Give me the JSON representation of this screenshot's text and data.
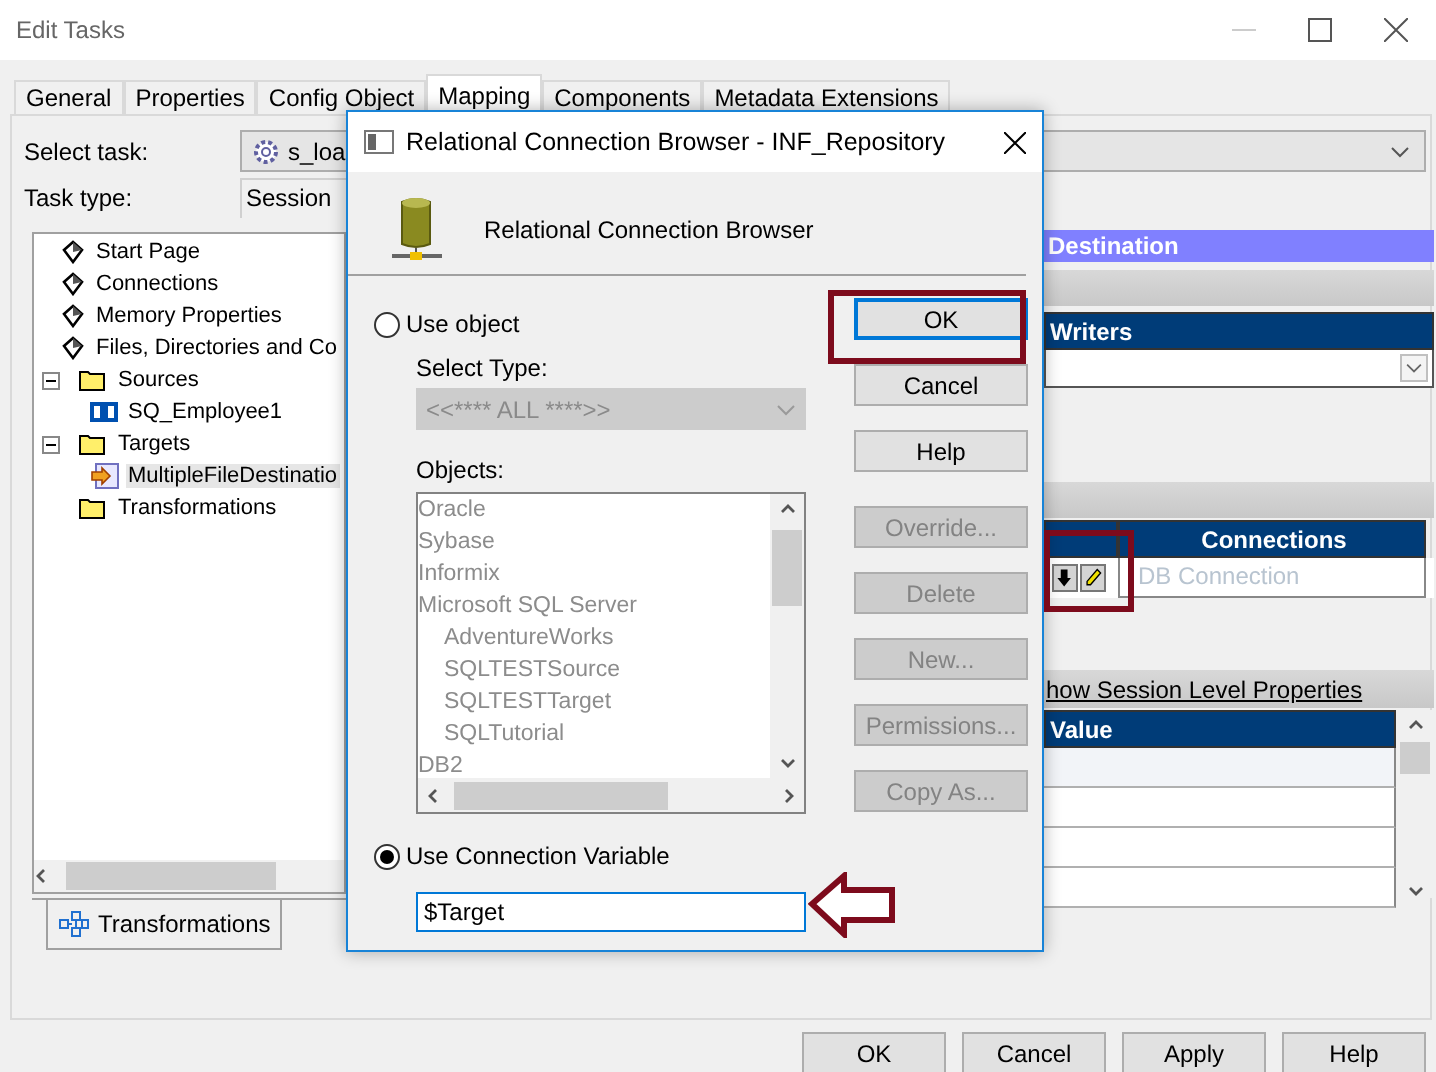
{
  "window": {
    "title": "Edit Tasks"
  },
  "tabs": [
    {
      "label": "General",
      "selected": false
    },
    {
      "label": "Properties",
      "selected": false
    },
    {
      "label": "Config Object",
      "selected": false
    },
    {
      "label": "Mapping",
      "selected": true
    },
    {
      "label": "Components",
      "selected": false
    },
    {
      "label": "Metadata Extensions",
      "selected": false
    }
  ],
  "task": {
    "select_label": "Select task:",
    "select_value": "s_loa",
    "type_label": "Task type:",
    "type_value": "Session"
  },
  "tree": [
    {
      "label": "Start Page",
      "kind": "page",
      "selected": false
    },
    {
      "label": "Connections",
      "kind": "page",
      "selected": false
    },
    {
      "label": "Memory Properties",
      "kind": "page",
      "selected": false
    },
    {
      "label": "Files, Directories and Co",
      "kind": "page",
      "selected": false
    },
    {
      "label": "Sources",
      "kind": "folder",
      "expanded": true,
      "selected": false,
      "children": [
        {
          "label": "SQ_Employee1",
          "kind": "source",
          "selected": false
        }
      ]
    },
    {
      "label": "Targets",
      "kind": "folder",
      "expanded": true,
      "selected": false,
      "children": [
        {
          "label": "MultipleFileDestinatio",
          "kind": "target",
          "selected": true
        }
      ]
    },
    {
      "label": "Transformations",
      "kind": "folder",
      "selected": false
    }
  ],
  "bottom_tab": "Transformations",
  "properties": {
    "header": "Destination",
    "writers_header": "Writers",
    "connections_header": "Connections",
    "connection_value": "DB Connection",
    "link": "how Session Level Properties",
    "value_header": "Value"
  },
  "dialog": {
    "title": "Relational Connection Browser - INF_Repository",
    "heading": "Relational Connection Browser",
    "options": [
      {
        "label": "Use object",
        "selected": false
      },
      {
        "label": "Use Connection Variable",
        "selected": true
      }
    ],
    "select_type_label": "Select Type:",
    "select_type_value": "<<**** ALL ****>>",
    "objects_label": "Objects:",
    "objects": [
      {
        "label": "Oracle"
      },
      {
        "label": "Sybase"
      },
      {
        "label": "Informix"
      },
      {
        "label": "Microsoft SQL Server",
        "children": [
          {
            "label": "AdventureWorks"
          },
          {
            "label": "SQLTESTSource"
          },
          {
            "label": "SQLTESTTarget"
          },
          {
            "label": "SQLTutorial"
          }
        ]
      },
      {
        "label": "DB2"
      }
    ],
    "variable_value": "$Target",
    "buttons": [
      {
        "label": "OK",
        "disabled": false,
        "default": true
      },
      {
        "label": "Cancel",
        "disabled": false,
        "default": false
      },
      {
        "label": "Help",
        "disabled": false,
        "default": false
      },
      {
        "label": "Override...",
        "disabled": true,
        "default": false
      },
      {
        "label": "Delete",
        "disabled": true,
        "default": false
      },
      {
        "label": "New...",
        "disabled": true,
        "default": false
      },
      {
        "label": "Permissions...",
        "disabled": true,
        "default": false
      },
      {
        "label": "Copy As...",
        "disabled": true,
        "default": false
      }
    ]
  },
  "buttons": [
    "OK",
    "Cancel",
    "Apply",
    "Help"
  ]
}
